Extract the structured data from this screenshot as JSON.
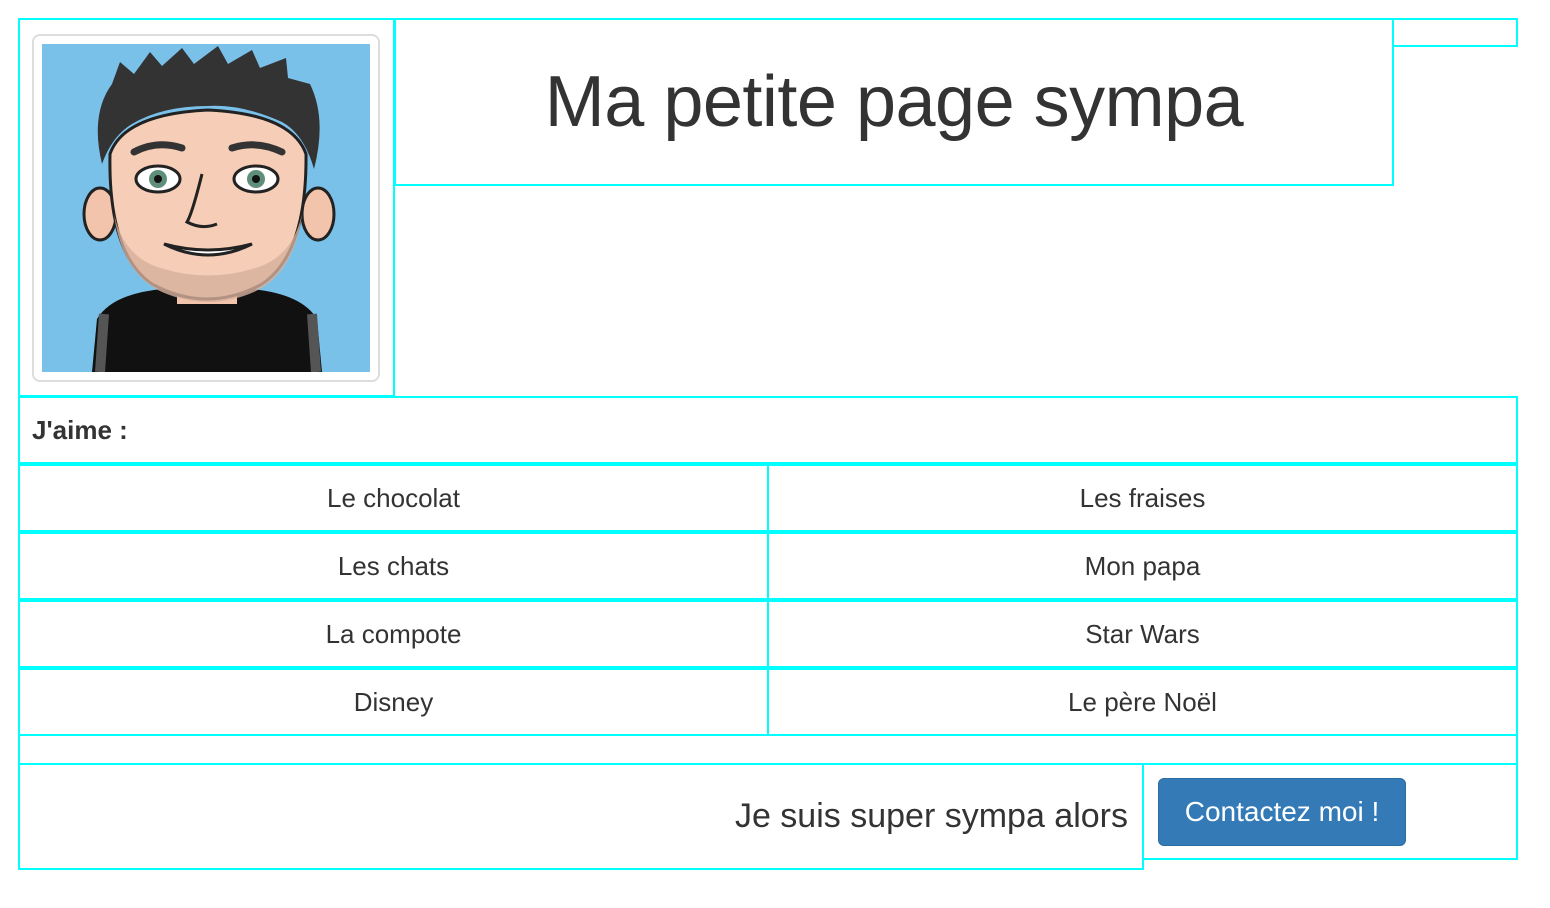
{
  "header": {
    "title": "Ma petite page sympa",
    "avatar_icon": "avatar-image"
  },
  "likes": {
    "label": "J'aime :",
    "items": [
      [
        "Le chocolat",
        "Les fraises"
      ],
      [
        "Les chats",
        "Mon papa"
      ],
      [
        "La compote",
        "Star Wars"
      ],
      [
        "Disney",
        "Le père Noël"
      ]
    ]
  },
  "footer": {
    "text": "Je suis super sympa alors",
    "contact_button": "Contactez moi !"
  },
  "colors": {
    "outline": "#00ffff",
    "text": "#333333",
    "button": "#337ab7",
    "avatar_bg": "#7ac1ea"
  }
}
